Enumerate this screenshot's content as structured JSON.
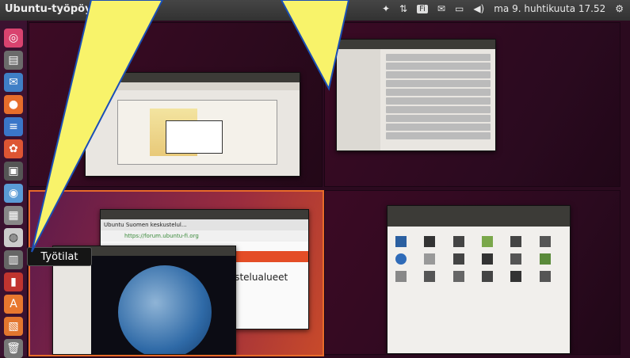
{
  "panel": {
    "title": "Ubuntu-työpöytä",
    "date_time": "ma 9. huhtikuuta 17.52",
    "indicators": [
      "dropbox-icon",
      "network-icon",
      "keyboard-icon",
      "mail-icon",
      "battery-icon",
      "volume-icon",
      "gear-icon"
    ],
    "keyboard_label": "Fi"
  },
  "launcher": {
    "items": [
      {
        "icon": "search-icon",
        "color": "#d9436f"
      },
      {
        "icon": "files-icon",
        "color": "#6b6b6b"
      },
      {
        "icon": "thunderbird-icon",
        "color": "#3f7fc6"
      },
      {
        "icon": "firefox-icon",
        "color": "#e66d2b"
      },
      {
        "icon": "text-editor-icon",
        "color": "#3a76c9"
      },
      {
        "icon": "settings-icon",
        "color": "#dd5533"
      },
      {
        "icon": "terminal-icon",
        "color": "#555555"
      },
      {
        "icon": "earth-icon",
        "color": "#5a9bd6"
      },
      {
        "icon": "photos-icon",
        "color": "#888888"
      },
      {
        "icon": "disk-icon",
        "color": "#cccccc"
      },
      {
        "icon": "workspaces-icon",
        "color": "#666666"
      },
      {
        "icon": "store-icon",
        "color": "#c0342f"
      },
      {
        "icon": "software-icon",
        "color": "#e8772e"
      },
      {
        "icon": "document-icon",
        "color": "#e3762e"
      },
      {
        "icon": "trash-icon",
        "color": "#777777"
      }
    ]
  },
  "tooltip": "Työtilat",
  "ws3": {
    "browser_tab": "Ubuntu Suomen keskustelul...",
    "browser_url": "https://forum.ubuntu-fi.org",
    "page_heading": "kustelualueet"
  },
  "colors": {
    "callout_fill": "#f8f36a",
    "callout_stroke": "#1b4fb5",
    "active_border": "#e86a2a"
  }
}
